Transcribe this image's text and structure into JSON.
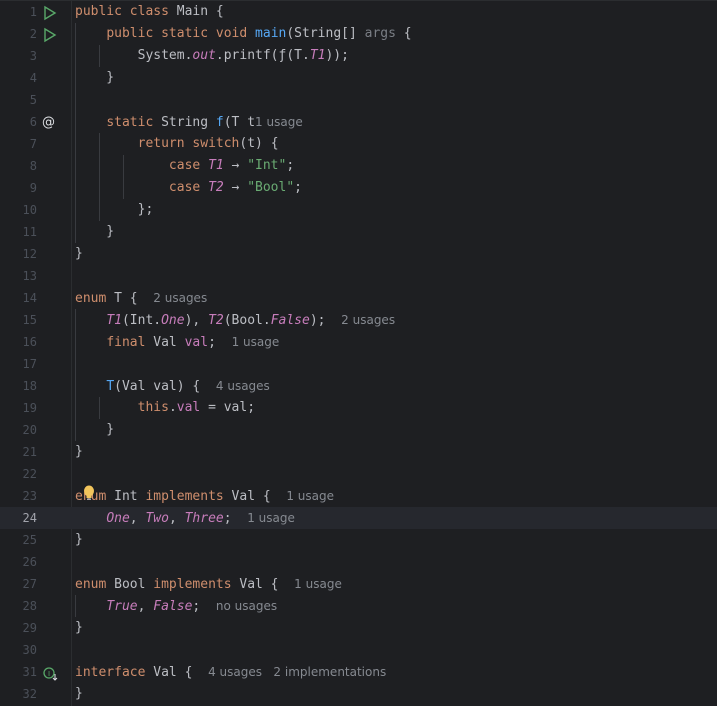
{
  "editor": {
    "language": "java",
    "current_line": 24,
    "lines": [
      {
        "n": "1",
        "tokens": [
          [
            "kw",
            "public "
          ],
          [
            "kw",
            "class "
          ],
          [
            "",
            "Main {"
          ]
        ]
      },
      {
        "n": "2",
        "tokens": [
          [
            "",
            "    "
          ],
          [
            "kw",
            "public "
          ],
          [
            "kw",
            "static "
          ],
          [
            "kw",
            "void "
          ],
          [
            "fn",
            "main"
          ],
          [
            "",
            "(String[] "
          ],
          [
            "param",
            "args"
          ],
          [
            "",
            " {"
          ]
        ]
      },
      {
        "n": "3",
        "tokens": [
          [
            "",
            "        System."
          ],
          [
            "st",
            "out"
          ],
          [
            "",
            ".printf("
          ],
          [
            "",
            "ƒ"
          ],
          [
            "",
            "(T."
          ],
          [
            "enc",
            "T1"
          ],
          [
            "",
            "));"
          ]
        ]
      },
      {
        "n": "4",
        "tokens": [
          [
            "",
            "    }"
          ]
        ]
      },
      {
        "n": "5",
        "tokens": []
      },
      {
        "n": "6",
        "tokens": [
          [
            "",
            "    "
          ],
          [
            "kw",
            "static "
          ],
          [
            "",
            "String "
          ],
          [
            "fn",
            "f"
          ],
          [
            "",
            "(T "
          ],
          [
            "",
            "t"
          ],
          [
            ") {  "
          ]
        ],
        "hint": "1 usage"
      },
      {
        "n": "7",
        "tokens": [
          [
            "",
            "        "
          ],
          [
            "kw",
            "return "
          ],
          [
            "kw",
            "switch"
          ],
          [
            "",
            "(t) {"
          ]
        ]
      },
      {
        "n": "8",
        "tokens": [
          [
            "",
            "            "
          ],
          [
            "kw",
            "case "
          ],
          [
            "enc",
            "T1"
          ],
          [
            "",
            " → "
          ],
          [
            "str",
            "\"Int\""
          ],
          [
            "",
            ";"
          ]
        ]
      },
      {
        "n": "9",
        "tokens": [
          [
            "",
            "            "
          ],
          [
            "kw",
            "case "
          ],
          [
            "enc",
            "T2"
          ],
          [
            "",
            " → "
          ],
          [
            "str",
            "\"Bool\""
          ],
          [
            "",
            ";"
          ]
        ]
      },
      {
        "n": "10",
        "tokens": [
          [
            "",
            "        };"
          ]
        ]
      },
      {
        "n": "11",
        "tokens": [
          [
            "",
            "    }"
          ]
        ]
      },
      {
        "n": "12",
        "tokens": [
          [
            "",
            "}"
          ]
        ]
      },
      {
        "n": "13",
        "tokens": []
      },
      {
        "n": "14",
        "tokens": [
          [
            "kw",
            "enum "
          ],
          [
            "",
            "T {  "
          ]
        ],
        "hint": "2 usages"
      },
      {
        "n": "15",
        "tokens": [
          [
            "",
            "    "
          ],
          [
            "enc",
            "T1"
          ],
          [
            "",
            "(Int."
          ],
          [
            "enc",
            "One"
          ],
          [
            "",
            "), "
          ],
          [
            "enc",
            "T2"
          ],
          [
            "",
            "(Bool."
          ],
          [
            "enc",
            "False"
          ],
          [
            "",
            ");  "
          ]
        ],
        "hint": "2 usages"
      },
      {
        "n": "16",
        "tokens": [
          [
            "",
            "    "
          ],
          [
            "kw",
            "final "
          ],
          [
            "",
            "Val "
          ],
          [
            "fld",
            "val"
          ],
          [
            "",
            ";  "
          ]
        ],
        "hint": "1 usage"
      },
      {
        "n": "17",
        "tokens": []
      },
      {
        "n": "18",
        "tokens": [
          [
            "",
            "    "
          ],
          [
            "fn",
            "T"
          ],
          [
            "",
            "(Val val) {  "
          ]
        ],
        "hint": "4 usages"
      },
      {
        "n": "19",
        "tokens": [
          [
            "",
            "        "
          ],
          [
            "kw",
            "this"
          ],
          [
            "",
            "."
          ],
          [
            "fld",
            "val"
          ],
          [
            "",
            " = val;"
          ]
        ]
      },
      {
        "n": "20",
        "tokens": [
          [
            "",
            "    }"
          ]
        ]
      },
      {
        "n": "21",
        "tokens": [
          [
            "",
            "}"
          ]
        ]
      },
      {
        "n": "22",
        "tokens": []
      },
      {
        "n": "23",
        "tokens": [
          [
            "kw",
            "enum "
          ],
          [
            "",
            "Int "
          ],
          [
            "kw",
            "implements "
          ],
          [
            "",
            "Val {  "
          ]
        ],
        "hint": "1 usage"
      },
      {
        "n": "24",
        "tokens": [
          [
            "",
            "    "
          ],
          [
            "enc",
            "One"
          ],
          [
            "",
            ", "
          ],
          [
            "enc",
            "Two"
          ],
          [
            "",
            ", "
          ],
          [
            "enc",
            "Three"
          ],
          [
            "",
            ";  "
          ]
        ],
        "hint": "1 usage"
      },
      {
        "n": "25",
        "tokens": [
          [
            "",
            "}"
          ]
        ]
      },
      {
        "n": "26",
        "tokens": []
      },
      {
        "n": "27",
        "tokens": [
          [
            "kw",
            "enum "
          ],
          [
            "",
            "Bool "
          ],
          [
            "kw",
            "implements "
          ],
          [
            "",
            "Val {  "
          ]
        ],
        "hint": "1 usage"
      },
      {
        "n": "28",
        "tokens": [
          [
            "",
            "    "
          ],
          [
            "enc",
            "True"
          ],
          [
            "",
            ", "
          ],
          [
            "enc",
            "False"
          ],
          [
            "",
            ";  "
          ]
        ],
        "hint": "no usages"
      },
      {
        "n": "29",
        "tokens": [
          [
            "",
            "}"
          ]
        ]
      },
      {
        "n": "30",
        "tokens": []
      },
      {
        "n": "31",
        "tokens": [
          [
            "kw",
            "interface "
          ],
          [
            "",
            "Val {  "
          ]
        ],
        "hint": "4 usages   2 implementations"
      },
      {
        "n": "32",
        "tokens": [
          [
            "",
            "}"
          ]
        ]
      }
    ]
  },
  "gutter_icons": {
    "run_line_1": "run-icon",
    "run_line_2": "run-icon",
    "override_line_6": "at-icon",
    "impl_line_31": "implemented-icon"
  },
  "colors": {
    "background": "#1e1f22",
    "keyword": "#cf8e6d",
    "function": "#56a8f5",
    "string": "#6aab73",
    "enum_constant": "#c77dbb",
    "run_icon": "#59a869",
    "bulb": "#f2c55c"
  }
}
